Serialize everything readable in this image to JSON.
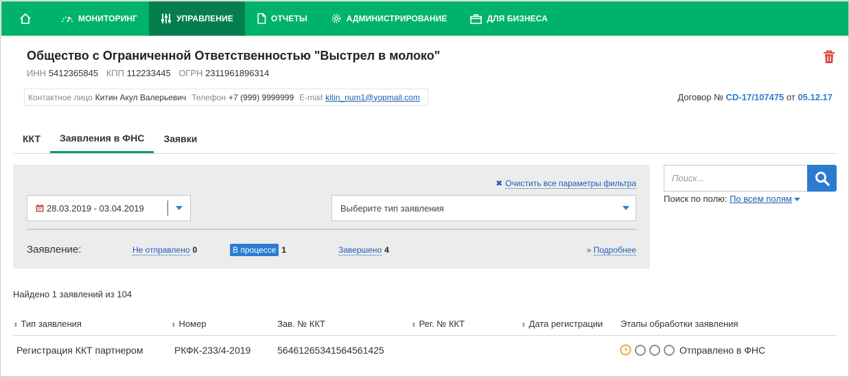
{
  "nav": {
    "items": [
      {
        "label": "МОНИТОРИНГ",
        "icon": "gauge-icon",
        "active": false
      },
      {
        "label": "УПРАВЛЕНИЕ",
        "icon": "sliders-icon",
        "active": true
      },
      {
        "label": "ОТЧЕТЫ",
        "icon": "document-icon",
        "active": false
      },
      {
        "label": "АДМИНИСТРИРОВАНИЕ",
        "icon": "gear-icon",
        "active": false
      },
      {
        "label": "ДЛЯ БИЗНЕСА",
        "icon": "briefcase-icon",
        "active": false
      }
    ]
  },
  "org": {
    "title": "Общество с Ограниченной Ответственностью \"Выстрел в молоко\"",
    "inn_label": "ИНН",
    "inn": "5412365845",
    "kpp_label": "КПП",
    "kpp": "112233445",
    "ogrn_label": "ОГРН",
    "ogrn": "2311961896314"
  },
  "contact": {
    "person_label": "Контактное лицо",
    "person": "Китин Акул Валерьевич",
    "phone_label": "Телефон",
    "phone": "+7 (999) 9999999",
    "email_label": "E-mail",
    "email": "kitin_num1@yopmail.com"
  },
  "contract": {
    "prefix": "Договор №",
    "number": "CD-17/107475",
    "date_prefix": "от",
    "date": "05.12.17"
  },
  "tabs": [
    {
      "label": "ККТ",
      "active": false
    },
    {
      "label": "Заявления в ФНС",
      "active": true
    },
    {
      "label": "Заявки",
      "active": false
    }
  ],
  "filter": {
    "clear_label": "Очистить все параметры фильтра",
    "date_range": "28.03.2019 - 03.04.2019",
    "type_placeholder": "Выберите тип заявления",
    "status_label": "Заявление:",
    "statuses": [
      {
        "label": "Не отправлено",
        "count": "0"
      },
      {
        "label": "В процессе",
        "count": "1"
      },
      {
        "label": "Завершено",
        "count": "4"
      }
    ],
    "more_label": "Подробнее"
  },
  "search": {
    "placeholder": "Поиск...",
    "field_label": "Поиск по полю:",
    "field_value": "По всем полям"
  },
  "results": {
    "found_text": "Найдено 1 заявлений из 104",
    "columns": [
      "Тип заявления",
      "Номер",
      "Зав. № ККТ",
      "Рег. № ККТ",
      "Дата регистрации",
      "Этапы обработки заявления"
    ],
    "rows": [
      {
        "type": "Регистрация ККТ партнером",
        "number": "РКФК-233/4-2019",
        "serial": "56461265341564561425",
        "reg": "",
        "date": "",
        "stage_text": "Отправлено в ФНС"
      }
    ]
  },
  "colors": {
    "nav_bg": "#00b36b",
    "nav_active": "#057e4d",
    "accent_blue": "#2c7bd1",
    "link": "#1a5fb4",
    "trash_red": "#d9463a",
    "pending_orange": "#e8a93a"
  }
}
